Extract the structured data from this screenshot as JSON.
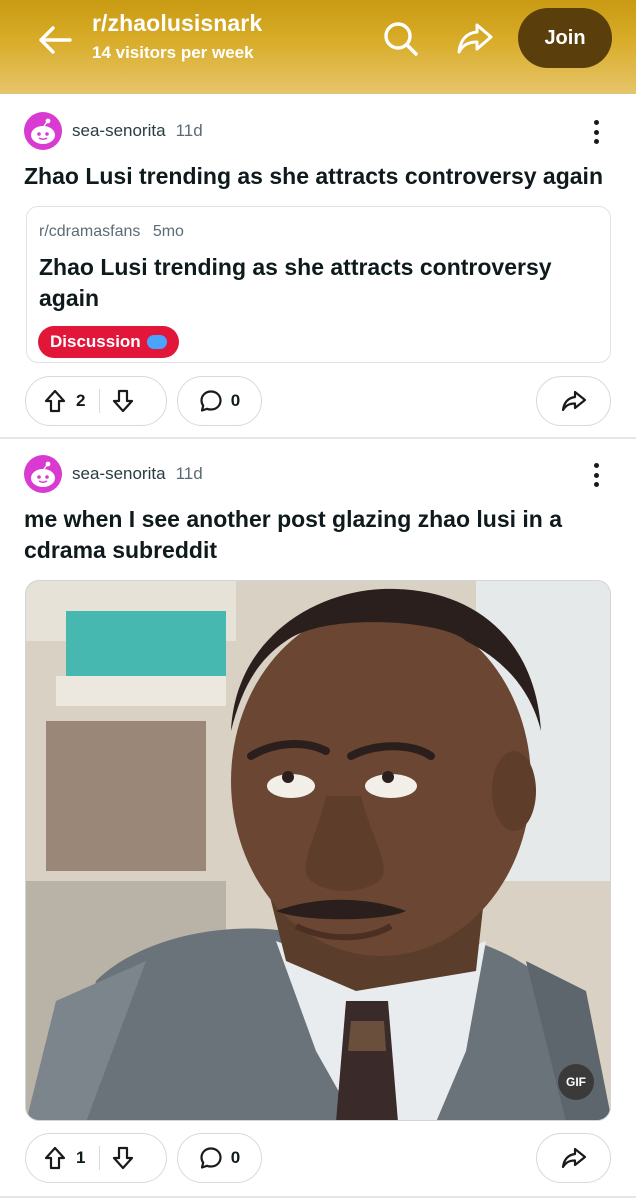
{
  "header": {
    "subreddit": "r/zhaolusisnark",
    "visitors": "14 visitors per week",
    "join_label": "Join",
    "icons": [
      "back-arrow-icon",
      "search-icon",
      "share-icon"
    ]
  },
  "posts": [
    {
      "author": "sea-senorita",
      "age": "11d",
      "title": "Zhao Lusi trending as she attracts controversy again",
      "crosspost": {
        "subreddit": "r/cdramasfans",
        "age": "5mo",
        "title": "Zhao Lusi trending as she attracts controversy again",
        "flair": "Discussion"
      },
      "upvotes": "2",
      "comments": "0"
    },
    {
      "author": "sea-senorita",
      "age": "11d",
      "title": "me when I see another post glazing zhao lusi in a cdrama subreddit",
      "media_badge": "GIF",
      "upvotes": "1",
      "comments": "0"
    }
  ],
  "colors": {
    "header_gold": "#d9ad2a",
    "join_button": "#5a3f0d",
    "flair_red": "#e21639",
    "avatar_pink": "#d93ad1"
  }
}
